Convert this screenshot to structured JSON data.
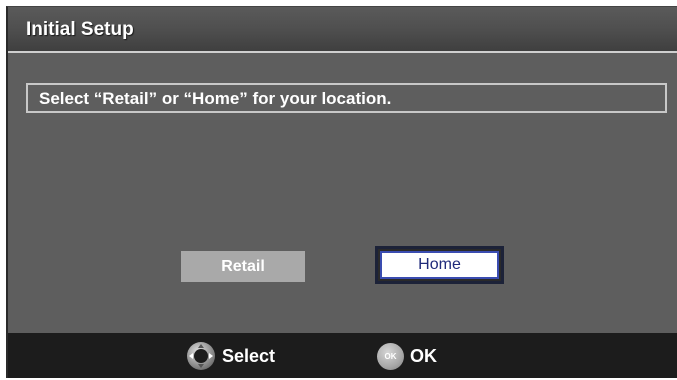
{
  "header": {
    "title": "Initial Setup"
  },
  "main": {
    "instruction": "Select “Retail” or “Home” for your location.",
    "options": [
      {
        "label": "Retail",
        "selected": false
      },
      {
        "label": "Home",
        "selected": true
      }
    ]
  },
  "footer": {
    "select_label": "Select",
    "select_icon": "dpad-icon",
    "ok_icon_text": "OK",
    "ok_label": "OK"
  },
  "colors": {
    "background": "#5e5e5e",
    "footer": "#1c1c1c",
    "selected_border": "#3a4cb0",
    "selected_text": "#1f2a7a",
    "unselected_option": "#a9a9a9"
  }
}
